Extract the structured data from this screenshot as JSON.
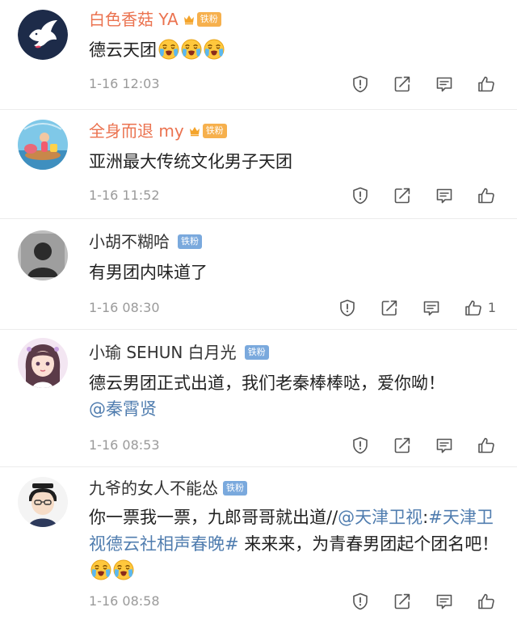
{
  "comments": [
    {
      "username": "白色香菇 YA",
      "badge": "铁粉",
      "text": "德云天团",
      "emoji": "😭",
      "time": "1-16 12:03",
      "likes": ""
    },
    {
      "username": "全身而退 my",
      "badge": "铁粉",
      "text": "亚洲最大传统文化男子天团",
      "time": "1-16 11:52",
      "likes": ""
    },
    {
      "username": "小胡不糊哈",
      "badge": "铁粉",
      "text": "有男团内味道了",
      "time": "1-16 08:30",
      "likes": "1"
    },
    {
      "username": "小瑜 SEHUN 白月光",
      "badge": "铁粉",
      "text": "德云男团正式出道，我们老秦棒棒哒，爱你呦！",
      "mention": "@秦霄贤",
      "time": "1-16 08:53",
      "likes": ""
    },
    {
      "username": "九爷的女人不能怂",
      "badge": "铁粉",
      "text_before": "你一票我一票，九郎哥哥就出道//",
      "mention": "@天津卫视",
      "text_colon": ":",
      "topic": "#天津卫视德云社相声春晚#",
      "text_after": " 来来来，为青春男团起个团名吧！",
      "time": "1-16 08:58",
      "likes": ""
    }
  ],
  "colors": {
    "vip_name": "#eb7350",
    "link": "#507daf",
    "meta": "#9a9a9a",
    "gold_badge": "#f6b04d",
    "blue_badge": "#7aa9dd"
  },
  "icons": {
    "report": "report-icon",
    "repost": "repost-icon",
    "reply": "comment-icon",
    "like": "like-icon",
    "member": "crown-icon",
    "emoji": "crying-emoji-icon"
  }
}
